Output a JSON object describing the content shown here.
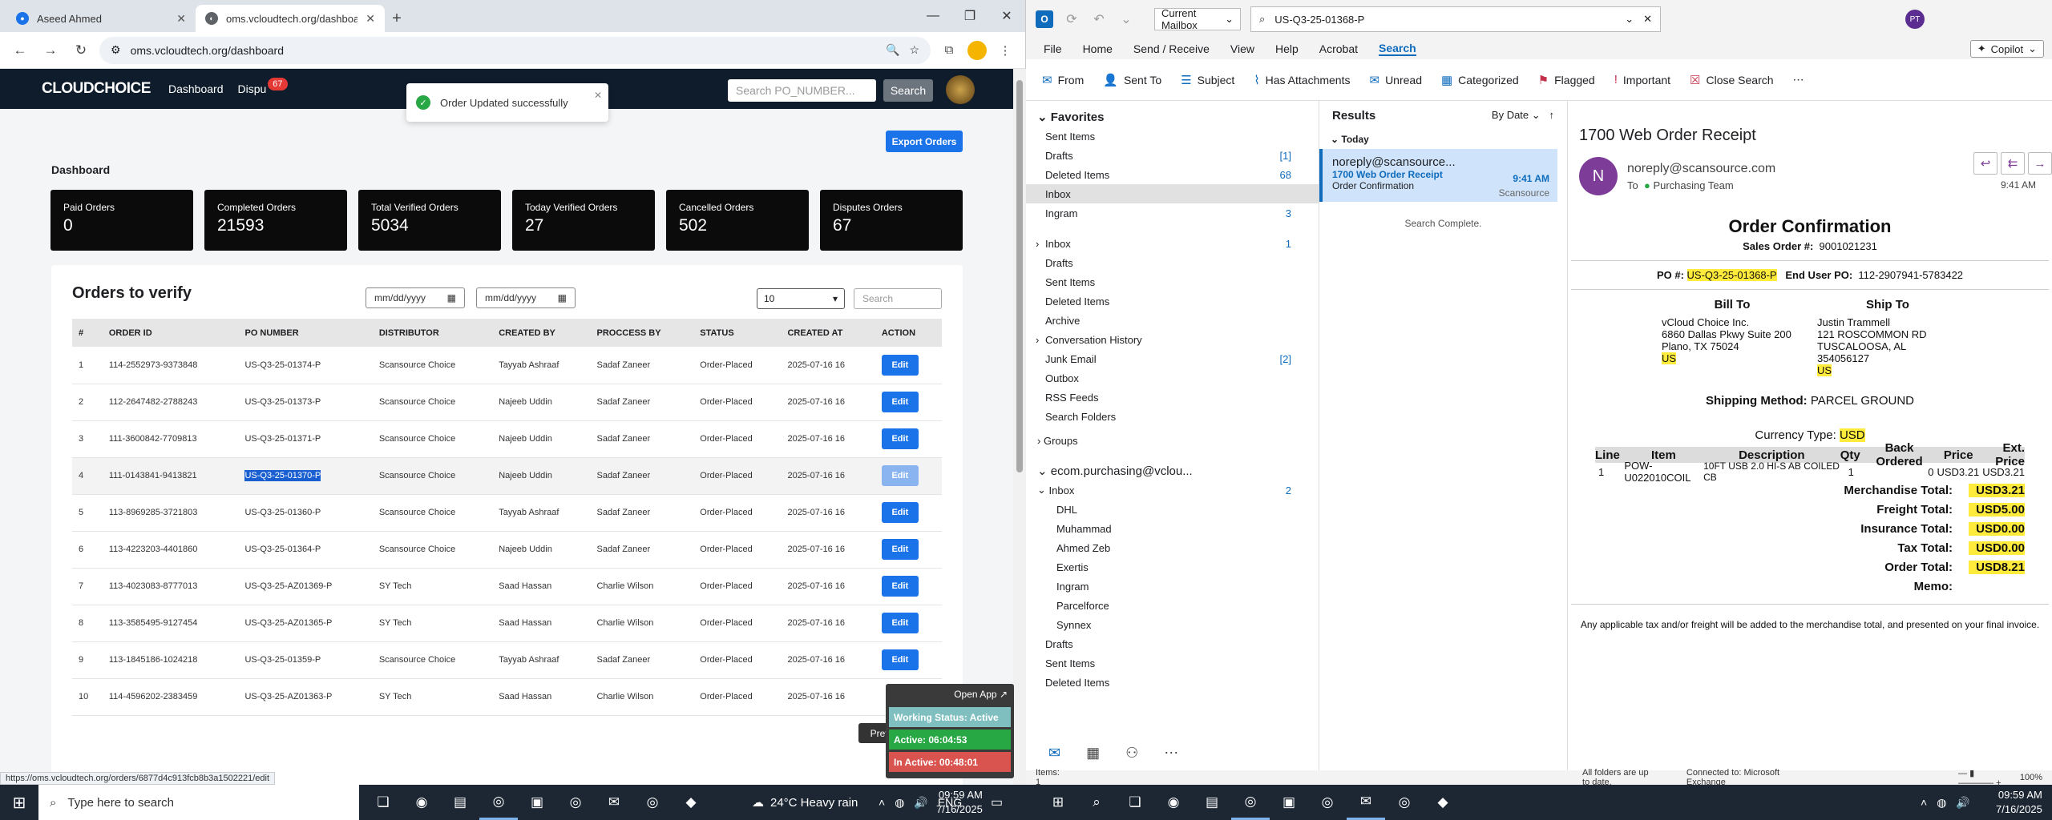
{
  "browser": {
    "tabs": [
      {
        "title": "Aseed Ahmed",
        "active": false
      },
      {
        "title": "oms.vcloudtech.org/dashboard",
        "active": true
      }
    ],
    "url": "oms.vcloudtech.org/dashboard",
    "status_url": "https://oms.vcloudtech.org/orders/6877d4c913fcb8b3a1502221/edit"
  },
  "app": {
    "logo": "CLOUDCHOICE",
    "nav_dashboard": "Dashboard",
    "nav_disputes": "Dispu",
    "disputes_badge": "67",
    "search_placeholder": "Search PO_NUMBER...",
    "search_button": "Search",
    "toast": "Order Updated successfully",
    "export_button": "Export Orders",
    "page_heading": "Dashboard",
    "cards": [
      {
        "label": "Paid Orders",
        "value": "0"
      },
      {
        "label": "Completed Orders",
        "value": "21593"
      },
      {
        "label": "Total Verified Orders",
        "value": "5034"
      },
      {
        "label": "Today Verified Orders",
        "value": "27"
      },
      {
        "label": "Cancelled Orders",
        "value": "502"
      },
      {
        "label": "Disputes Orders",
        "value": "67"
      }
    ],
    "panel_title": "Orders to verify",
    "date_placeholder": "mm/dd/yyyy",
    "page_size": "10",
    "table_search_placeholder": "Search",
    "columns": [
      "#",
      "ORDER ID",
      "PO NUMBER",
      "DISTRIBUTOR",
      "CREATED BY",
      "PROCCESS BY",
      "STATUS",
      "CREATED AT",
      "ACTION"
    ],
    "rows": [
      {
        "n": "1",
        "order_id": "114-2552973-9373848",
        "po": "US-Q3-25-01374-P",
        "distributor": "Scansource Choice",
        "created_by": "Tayyab Ashraaf",
        "process_by": "Sadaf Zaneer",
        "status": "Order-Placed",
        "created_at": "2025-07-16 16"
      },
      {
        "n": "2",
        "order_id": "112-2647482-2788243",
        "po": "US-Q3-25-01373-P",
        "distributor": "Scansource Choice",
        "created_by": "Najeeb Uddin",
        "process_by": "Sadaf Zaneer",
        "status": "Order-Placed",
        "created_at": "2025-07-16 16"
      },
      {
        "n": "3",
        "order_id": "111-3600842-7709813",
        "po": "US-Q3-25-01371-P",
        "distributor": "Scansource Choice",
        "created_by": "Najeeb Uddin",
        "process_by": "Sadaf Zaneer",
        "status": "Order-Placed",
        "created_at": "2025-07-16 16"
      },
      {
        "n": "4",
        "order_id": "111-0143841-9413821",
        "po": "US-Q3-25-01370-P",
        "distributor": "Scansource Choice",
        "created_by": "Najeeb Uddin",
        "process_by": "Sadaf Zaneer",
        "status": "Order-Placed",
        "created_at": "2025-07-16 16"
      },
      {
        "n": "5",
        "order_id": "113-8969285-3721803",
        "po": "US-Q3-25-01360-P",
        "distributor": "Scansource Choice",
        "created_by": "Tayyab Ashraaf",
        "process_by": "Sadaf Zaneer",
        "status": "Order-Placed",
        "created_at": "2025-07-16 16"
      },
      {
        "n": "6",
        "order_id": "113-4223203-4401860",
        "po": "US-Q3-25-01364-P",
        "distributor": "Scansource Choice",
        "created_by": "Najeeb Uddin",
        "process_by": "Sadaf Zaneer",
        "status": "Order-Placed",
        "created_at": "2025-07-16 16"
      },
      {
        "n": "7",
        "order_id": "113-4023083-8777013",
        "po": "US-Q3-25-AZ01369-P",
        "distributor": "SY Tech",
        "created_by": "Saad Hassan",
        "process_by": "Charlie Wilson",
        "status": "Order-Placed",
        "created_at": "2025-07-16 16"
      },
      {
        "n": "8",
        "order_id": "113-3585495-9127454",
        "po": "US-Q3-25-AZ01365-P",
        "distributor": "SY Tech",
        "created_by": "Saad Hassan",
        "process_by": "Charlie Wilson",
        "status": "Order-Placed",
        "created_at": "2025-07-16 16"
      },
      {
        "n": "9",
        "order_id": "113-1845186-1024218",
        "po": "US-Q3-25-01359-P",
        "distributor": "Scansource Choice",
        "created_by": "Tayyab Ashraaf",
        "process_by": "Sadaf Zaneer",
        "status": "Order-Placed",
        "created_at": "2025-07-16 16"
      },
      {
        "n": "10",
        "order_id": "114-4596202-2383459",
        "po": "US-Q3-25-AZ01363-P",
        "distributor": "SY Tech",
        "created_by": "Saad Hassan",
        "process_by": "Charlie Wilson",
        "status": "Order-Placed",
        "created_at": "2025-07-16 16"
      }
    ],
    "edit_label": "Edit",
    "prev_label": "Prev",
    "popup": {
      "open_app": "Open App",
      "working": "Working Status: Active",
      "active": "Active: 06:04:53",
      "inactive": "In Active: 00:48:01"
    }
  },
  "outlook": {
    "mailbox": "Current Mailbox",
    "search_value": "US-Q3-25-01368-P",
    "avatar": "PT",
    "menu": [
      "File",
      "Home",
      "Send / Receive",
      "View",
      "Help",
      "Acrobat",
      "Search"
    ],
    "copilot": "Copilot",
    "ribbon": [
      "From",
      "Sent To",
      "Subject",
      "Has Attachments",
      "Unread",
      "Categorized",
      "Flagged",
      "Important",
      "Close Search"
    ],
    "favorites_header": "Favorites",
    "favorites": [
      {
        "name": "Sent Items",
        "count": ""
      },
      {
        "name": "Drafts",
        "count": "[1]"
      },
      {
        "name": "Deleted Items",
        "count": "68"
      },
      {
        "name": "Inbox",
        "count": ""
      },
      {
        "name": "Ingram",
        "count": "3"
      }
    ],
    "folders": [
      {
        "name": "Inbox",
        "count": "1"
      },
      {
        "name": "Drafts",
        "count": ""
      },
      {
        "name": "Sent Items",
        "count": ""
      },
      {
        "name": "Deleted Items",
        "count": ""
      },
      {
        "name": "Archive",
        "count": ""
      },
      {
        "name": "Conversation History",
        "count": ""
      },
      {
        "name": "Junk Email",
        "count": "[2]"
      },
      {
        "name": "Outbox",
        "count": ""
      },
      {
        "name": "RSS Feeds",
        "count": ""
      },
      {
        "name": "Search Folders",
        "count": ""
      }
    ],
    "groups": "Groups",
    "account": "ecom.purchasing@vclou...",
    "account_inbox": {
      "name": "Inbox",
      "count": "2"
    },
    "subfolders": [
      "DHL",
      "Muhammad",
      "Ahmed Zeb",
      "Exertis",
      "Ingram",
      "Parcelforce",
      "Synnex"
    ],
    "account_tail": [
      "Drafts",
      "Sent Items",
      "Deleted Items"
    ],
    "results_title": "Results",
    "sort": "By Date",
    "today": "Today",
    "result": {
      "from": "noreply@scansource...",
      "subject": "1700 Web Order Receipt",
      "preview": "Order Confirmation",
      "time": "9:41 AM",
      "account": "Scansource"
    },
    "search_complete": "Search Complete.",
    "message": {
      "subject": "1700 Web Order Receipt",
      "avatar": "N",
      "from": "noreply@scansource.com",
      "to_label": "To",
      "to": "Purchasing Team",
      "time": "9:41 AM"
    },
    "doc": {
      "heading": "Order Confirmation",
      "sales_order_label": "Sales Order #:",
      "sales_order": "9001021231",
      "po_label": "PO #:",
      "po": "US-Q3-25-01368-P",
      "end_user_label": "End User PO:",
      "end_user": "112-2907941-5783422",
      "bill_to_title": "Bill To",
      "bill_to": [
        "vCloud Choice Inc.",
        "6860 Dallas Pkwy Suite 200",
        "Plano, TX 75024",
        "US"
      ],
      "ship_to_title": "Ship To",
      "ship_to": [
        "Justin Trammell",
        "121 ROSCOMMON RD",
        "TUSCALOOSA, AL 354056127",
        "US"
      ],
      "ship_method_label": "Shipping Method:",
      "ship_method": "PARCEL GROUND",
      "currency_label": "Currency Type:",
      "currency": "USD",
      "line_headers": [
        "Line",
        "Item",
        "Description",
        "Qty",
        "Back Ordered",
        "Price",
        "Ext. Price"
      ],
      "line": {
        "line": "1",
        "item": "POW-U022010COIL",
        "description": "10FT USB 2.0 HI-S AB COILED CB",
        "qty": "1",
        "back": "0",
        "price": "USD3.21",
        "ext": "USD3.21"
      },
      "totals": [
        {
          "label": "Merchandise Total:",
          "value": "USD3.21"
        },
        {
          "label": "Freight Total:",
          "value": "USD5.00"
        },
        {
          "label": "Insurance Total:",
          "value": "USD0.00"
        },
        {
          "label": "Tax Total:",
          "value": "USD0.00"
        },
        {
          "label": "Order Total:",
          "value": "USD8.21"
        }
      ],
      "memo_label": "Memo:",
      "footer": "Any applicable tax and/or freight will be added to the merchandise total, and presented on your final invoice."
    },
    "status": {
      "items": "Items: 1",
      "uptodate": "All folders are up to date.",
      "connected": "Connected to: Microsoft Exchange",
      "zoom": "100%"
    }
  },
  "taskbar": {
    "search_placeholder": "Type here to search",
    "weather": "24°C  Heavy rain",
    "time_left": "09:59 AM",
    "date_left": "7/16/2025",
    "time_right": "09:59 AM",
    "date_right": "7/16/2025"
  }
}
